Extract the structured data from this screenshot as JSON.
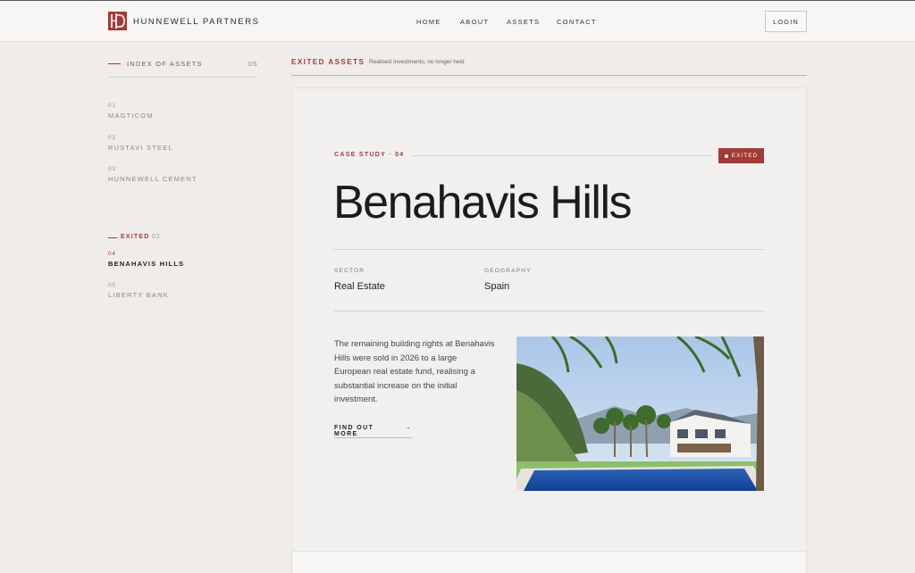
{
  "header": {
    "brand": "HUNNEWELL PARTNERS",
    "nav": [
      "HOME",
      "ABOUT",
      "ASSETS",
      "CONTACT"
    ],
    "login": "LOGIN"
  },
  "sidebar": {
    "heading": "INDEX OF ASSETS",
    "count": "05",
    "items": [
      {
        "num": "01",
        "label": "MAGTICOM"
      },
      {
        "num": "02",
        "label": "RUSTAVI STEEL"
      },
      {
        "num": "03",
        "label": "HUNNEWELL CEMENT"
      }
    ],
    "exited_label": "EXITED",
    "exited_count": "02",
    "exited_items": [
      {
        "num": "04",
        "label": "BENAHAVIS HILLS"
      },
      {
        "num": "05",
        "label": "LIBERTY BANK"
      }
    ]
  },
  "section": {
    "title": "EXITED ASSETS",
    "subtitle": "Realised investments, no longer held"
  },
  "case": {
    "label": "CASE STUDY · 04",
    "badge": "EXITED",
    "title": "Benahavis Hills",
    "sector_label": "SECTOR",
    "sector": "Real Estate",
    "geo_label": "GEOGRAPHY",
    "geo": "Spain",
    "description": "The remaining building rights at Benahavis Hills were sold in 2026 to a large European real estate fund, realising a substantial increase on the initial investment.",
    "cta": "FIND OUT MORE",
    "cta_arrow": "→"
  },
  "colors": {
    "accent": "#a33a35",
    "background": "#efecea",
    "card": "#f2f0ee"
  }
}
